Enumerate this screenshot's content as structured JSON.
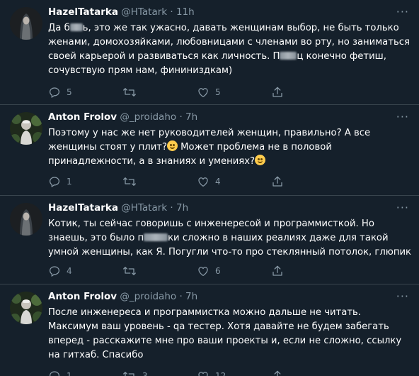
{
  "tweets": [
    {
      "name": "HazelTatarka",
      "handle": "@HTatark",
      "time": "11h",
      "text_parts": [
        "Да б",
        "ь, это же так ужасно, давать женщинам выбор, не быть только женами, домохозяйками, любовницами с членами во рту, но заниматься своей карьерой и развиваться как личность. П",
        "ц конечно фетиш, сочувствую прям нам, фининиздкам)"
      ],
      "reply_count": "5",
      "retweet_count": "",
      "like_count": "5"
    },
    {
      "name": "Anton Frolov",
      "handle": "@_proidaho",
      "time": "7h",
      "text_parts": [
        "Поэтому у нас же нет руководителей женщин, правильно? А все женщины стоят у плит?",
        " Может проблема не в половой принадлежности, а в знаниях и умениях?"
      ],
      "reply_count": "1",
      "retweet_count": "",
      "like_count": "4"
    },
    {
      "name": "HazelTatarka",
      "handle": "@HTatark",
      "time": "7h",
      "text_parts": [
        "Котик, ты сейчас говоришь с инженересой и программисткой. Но знаешь, это было п",
        "ки сложно в наших реалиях даже для такой умной женщины, как Я. Погугли что-то про стеклянный потолок, глюпик"
      ],
      "reply_count": "4",
      "retweet_count": "",
      "like_count": "6"
    },
    {
      "name": "Anton Frolov",
      "handle": "@_proidaho",
      "time": "7h",
      "text_parts": [
        "После инженереса и программистка можно дальше не читать. Максимум ваш уровень - qa тестер. Хотя давайте не будем забегать вперед - расскажите мне про ваши проекты и, если не сложно, ссылку на гитхаб. Спасибо"
      ],
      "reply_count": "1",
      "retweet_count": "3",
      "like_count": "12"
    }
  ],
  "colors": {
    "background": "#15202b",
    "muted": "#8899a6",
    "divider": "#38444d"
  }
}
